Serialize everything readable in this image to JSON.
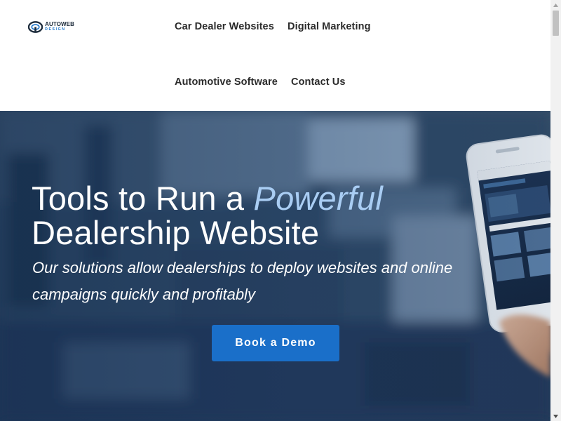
{
  "brand": {
    "name_line1": "AUTOWEB",
    "name_line2": "DESIGN",
    "logo_icon": "steering-wheel-icon"
  },
  "nav": {
    "items": [
      {
        "label": "Car Dealer Websites"
      },
      {
        "label": "Digital Marketing"
      },
      {
        "label": "Automotive Software"
      },
      {
        "label": "Contact Us"
      }
    ]
  },
  "hero": {
    "title_part1": "Tools to Run a ",
    "title_accent": "Powerful",
    "title_part2": "Dealership Website",
    "subtitle": "Our solutions allow dealerships to deploy websites and online campaigns quickly and profitably",
    "cta_label": "Book a Demo"
  },
  "colors": {
    "accent": "#1a6fc9",
    "title_accent": "#a9cdf3",
    "hero_bg": "#2c4663"
  }
}
